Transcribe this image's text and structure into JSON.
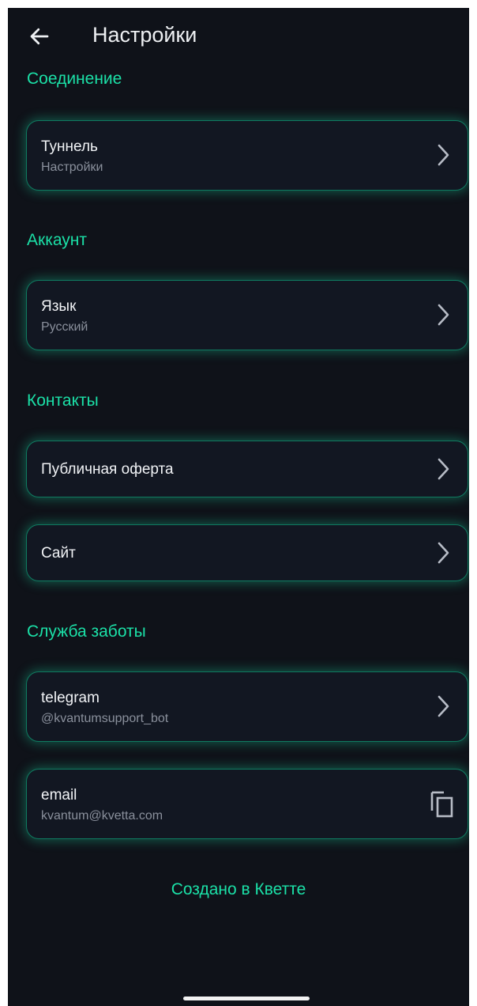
{
  "header": {
    "title": "Настройки",
    "back_icon": "arrow-left-icon"
  },
  "sections": {
    "connection": {
      "title": "Соединение",
      "tunnel": {
        "title": "Туннель",
        "subtitle": "Настройки"
      }
    },
    "account": {
      "title": "Аккаунт",
      "language": {
        "title": "Язык",
        "subtitle": "Русский"
      }
    },
    "contacts": {
      "title": "Контакты",
      "offer": {
        "title": "Публичная оферта"
      },
      "site": {
        "title": "Сайт"
      }
    },
    "support": {
      "title": "Служба заботы",
      "telegram": {
        "title": "telegram",
        "subtitle": "@kvantumsupport_bot"
      },
      "email": {
        "title": "email",
        "subtitle": "kvantum@kvetta.com",
        "action_icon": "copy-icon"
      }
    }
  },
  "footer": {
    "credit": "Создано в Кветте"
  },
  "colors": {
    "background": "#0f1219",
    "accent": "#1be0a7",
    "card": "#121722",
    "card_border": "#0f7a60",
    "text_primary": "#f1f3f6",
    "text_secondary": "#8a909c"
  }
}
